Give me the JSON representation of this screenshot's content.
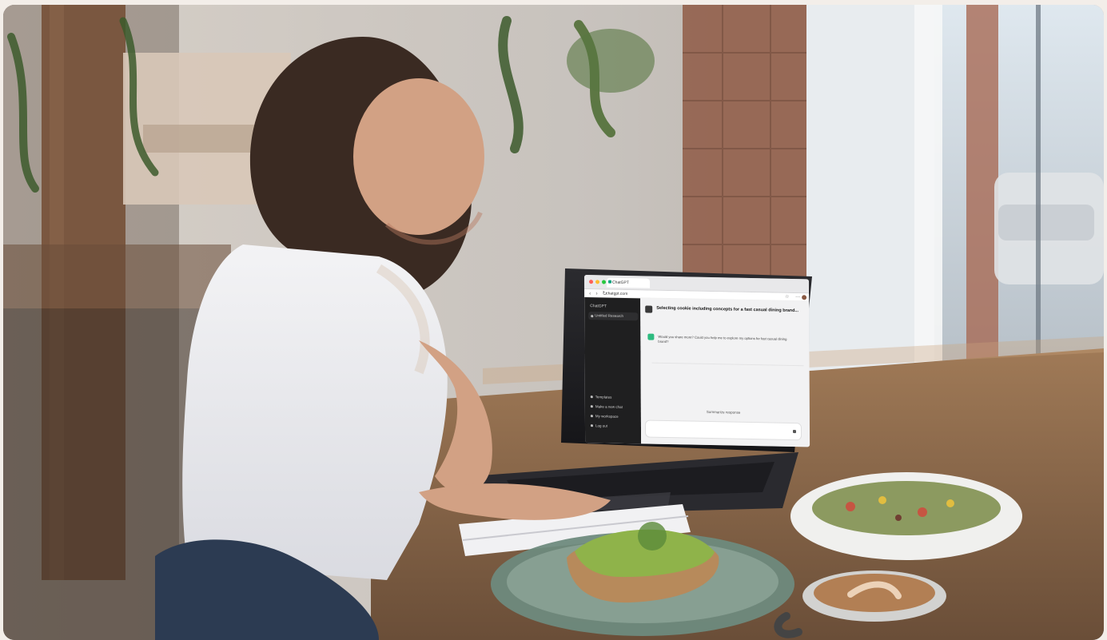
{
  "image": {
    "subject": "Woman using a laptop in a cafe",
    "setting": "Cafe interior by a window"
  },
  "laptop_screen": {
    "browser": {
      "tab_title": "ChatGPT",
      "url": "chatgpt.com",
      "nav_glyphs": "‹ › ↻",
      "right_glyphs": "☆ ⋯"
    },
    "sidebar": {
      "title": "ChatGPT",
      "new_chat": "Untitled Research",
      "menu": [
        {
          "label": "Templates"
        },
        {
          "label": "Make a new chat"
        },
        {
          "label": "My workspace"
        },
        {
          "label": "Log out"
        }
      ]
    },
    "chat": {
      "topic": "Selecting cookie including concepts for a fast casual dining brand...",
      "message": "Would you share more? Could you help me to explore my options for fast casual dining brand?",
      "suggestion": "Summarize response",
      "composer_placeholder": ""
    }
  },
  "colors": {
    "background": "#f3eee9",
    "screen_sidebar": "#1f1f20",
    "screen_main": "#f2f2f3",
    "accent_green": "#2dbb7f"
  }
}
